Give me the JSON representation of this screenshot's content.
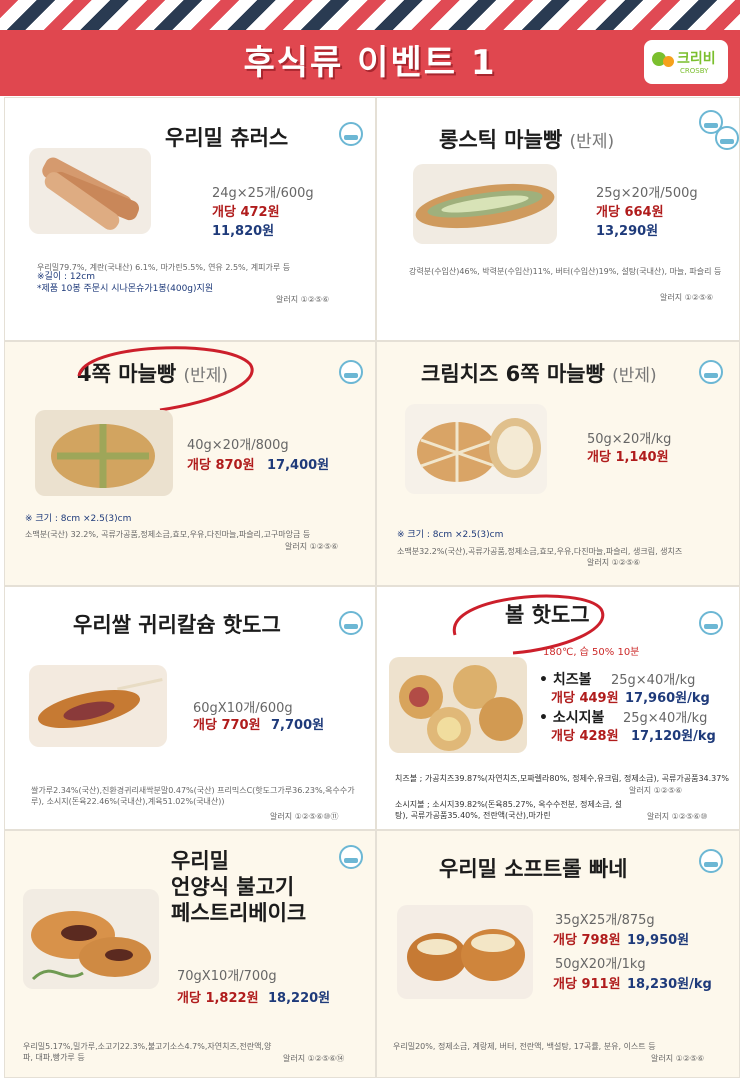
{
  "header": {
    "title": "후식류 이벤트 1",
    "logo_text": "크리비",
    "logo_sub": "CROSBY"
  },
  "colors": {
    "banner": "#e0474f",
    "price_unit": "#b01c1c",
    "price_total": "#1e3a7a",
    "cream": "#fdf8ec"
  },
  "products": [
    {
      "title": "우리밀 츄러스",
      "half": "",
      "spec": "24g×25개/600g",
      "unit_price": "개당 472원",
      "total": "11,820원",
      "ingredients": "우리밀79.7%, 계란(국내산) 6.1%, 마가린5.5%, 연유 2.5%, 계피가루 등",
      "note1": "※길이 : 12cm",
      "note2": "*제품 10봉 주문시 시나몬슈가1봉(400g)지원",
      "allergy": "알러지 ①②⑤⑥",
      "haccp": "HACCP"
    },
    {
      "title": "롱스틱 마늘빵",
      "half": "(반제)",
      "spec": "25g×20개/500g",
      "unit_price": "개당 664원",
      "total": "13,290원",
      "ingredients": "강력분(수입산)46%, 박력분(수입산)11%, 버터(수입산)19%, 설탕(국내산), 마늘, 파슬리 등",
      "allergy": "알러지 ①②⑤⑥",
      "haccp": "HACCP"
    },
    {
      "title": "4쪽 마늘빵",
      "half": "(반제)",
      "spec": "40g×20개/800g",
      "unit_price": "개당 870원",
      "total": "17,400원",
      "size": "※ 크기 : 8cm ×2.5(3)cm",
      "ingredients": "소맥분(국산) 32.2%, 곡류가공품,정제소금,효모,우유,다진마늘,파슬리,고구마앙금 등",
      "allergy": "알러지 ①②⑤⑥",
      "haccp": "HACCP"
    },
    {
      "title": "크림치즈 6쪽 마늘빵",
      "half": "(반제)",
      "spec": "50g×20개/kg",
      "unit_price": "개당 1,140원",
      "total": "",
      "size": "※ 크기 : 8cm ×2.5(3)cm",
      "ingredients": "소맥분32.2%(국산),곡류가공품,정제소금,효모,우유,다진마늘,파슬리, 생크림, 생치즈",
      "allergy": "알러지 ①②⑤⑥",
      "haccp": "HACCP"
    },
    {
      "title": "우리쌀 귀리칼슘 핫도그",
      "half": "",
      "spec": "60gX10개/600g",
      "unit_price": "개당 770원",
      "total": "7,700원",
      "ingredients": "쌀가루2.34%(국산),진환경귀리새싹분말0.47%(국산) 프리믹스C(핫도그가루36.23%,옥수수가루), 소시지(돈육22.46%(국내산),계육51.02%(국내산))",
      "allergy": "알러지 ①②⑤⑥⑩⑪",
      "haccp": "HACCP"
    },
    {
      "title": "볼 핫도그",
      "half": "",
      "cook": "180℃, 습 50% 10분",
      "variants": [
        {
          "name": "• 치즈볼",
          "spec": "25g×40개/kg",
          "unit_price": "개당 449원",
          "total": "17,960원/kg"
        },
        {
          "name": "• 소시지볼",
          "spec": "25g×40개/kg",
          "unit_price": "개당 428원",
          "total": "17,120원/kg"
        }
      ],
      "ingredients1": "치즈볼 ; 가공치즈39.87%(자연치즈,모짜렐라80%, 정제수,유크림, 정제소금), 곡류가공품34.37%",
      "allergy1": "알러지 ①②⑤⑥",
      "ingredients2": "소시지볼 ; 소시지39.82%(돈육85.27%, 옥수수전분, 정제소금, 설탕), 곡류가공품35.40%, 전란액(국산),마가린",
      "allergy2": "알러지 ①②⑤⑥⑩",
      "haccp": "HACCP"
    },
    {
      "title_lines": [
        "우리밀",
        "언양식 불고기",
        "페스트리베이크"
      ],
      "spec": "70gX10개/700g",
      "unit_price": "개당 1,822원",
      "total": "18,220원",
      "ingredients": "우리밀5.17%,밀가루,소고기22.3%,불고기소스4.7%,자연치즈,전란액,양파, 대파,빵가루 등",
      "allergy": "알러지 ①②⑤⑥⑭",
      "haccp": "HACCP"
    },
    {
      "title": "우리밀 소프트롤 빠네",
      "half": "",
      "variants": [
        {
          "spec": "35gX25개/875g",
          "unit_price": "개당 798원",
          "total": "19,950원"
        },
        {
          "spec": "50gX20개/1kg",
          "unit_price": "개당 911원",
          "total": "18,230원/kg"
        }
      ],
      "ingredients": "우리밀20%, 정제소금, 계랑제, 버터, 전란액, 백설탕, 17곡률, 분유, 이스트 등",
      "allergy": "알러지 ①②⑤⑥",
      "haccp": "HACCP"
    }
  ]
}
